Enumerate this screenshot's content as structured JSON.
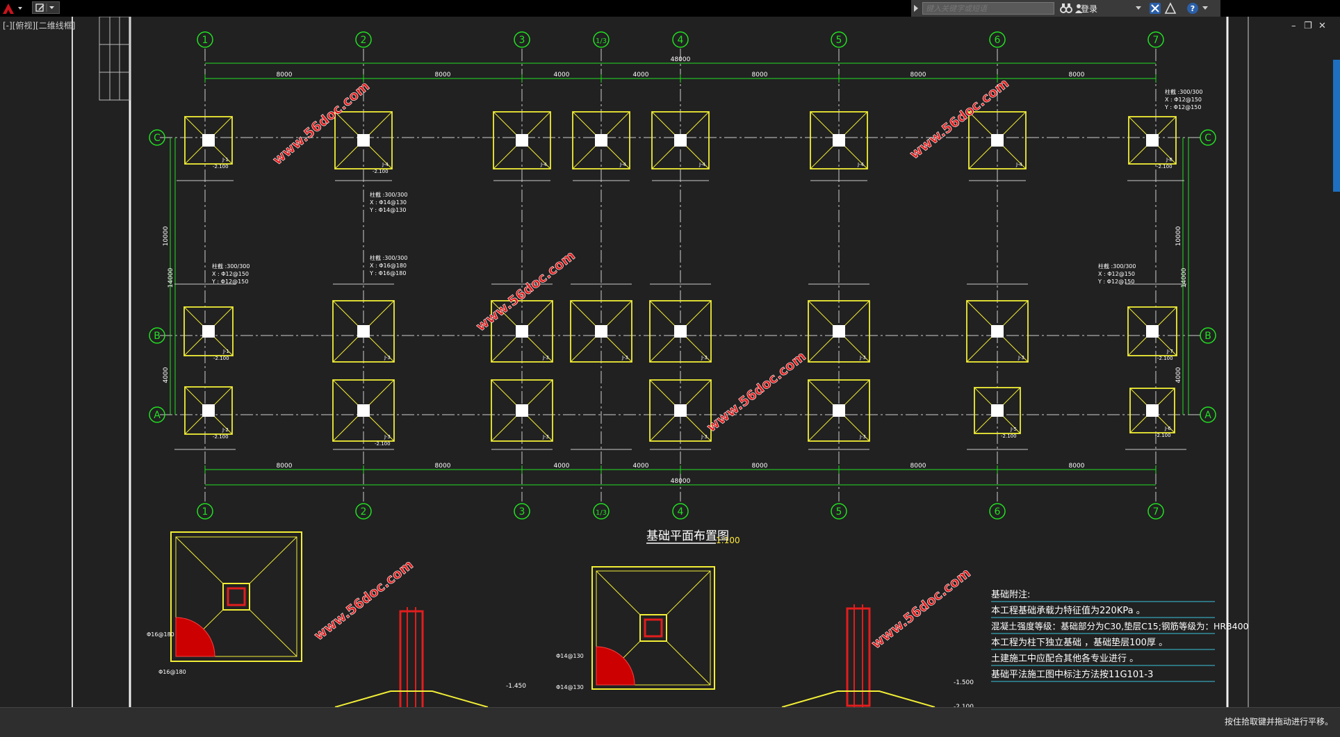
{
  "app": {
    "search_placeholder": "键入关键字或短语",
    "login_label": "登录",
    "view_label": "[-][俯视][二维线框]",
    "status_text": "按住拾取键并拖动进行平移。",
    "window_controls": [
      "–",
      "❐",
      "✕"
    ]
  },
  "drawing": {
    "plan_title": "基础平面布置图",
    "plan_scale": "1:100",
    "overall_dim": "48000",
    "bays_top": [
      "8000",
      "8000",
      "4000",
      "4000",
      "8000",
      "8000",
      "8000"
    ],
    "grid_cols": [
      "1",
      "2",
      "3",
      "1/3",
      "4",
      "5",
      "6",
      "7"
    ],
    "grid_rows": [
      "C",
      "B",
      "A"
    ],
    "left_dims": [
      "10000",
      "14000",
      "4000"
    ],
    "watermark": "www.56doc.com",
    "notes_title": "基础附注:",
    "notes": [
      "本工程基础承载力特征值为220KPa 。",
      "混凝土强度等级：基础部分为C30,垫层C15;钢筋等级为：HRB400",
      "本工程为柱下独立基础 ，基础垫层100厚 。",
      "土建施工中应配合其他各专业进行 。",
      "基础平法施工图中标注方法按11G101-3"
    ],
    "footing_labels": [
      "J-1",
      "J-2",
      "J-3",
      "J-4",
      "J-5",
      "J-6",
      "J-7",
      "J-8"
    ],
    "elev_label": "-2.100",
    "detail_rebar": [
      "Φ16@180",
      "Φ16@180",
      "Φ14@130",
      "Φ14@130"
    ],
    "detail_elev": [
      "-1.450",
      "-1.500",
      "-2.100"
    ],
    "pile_note_1": [
      "柱截 :300/300",
      "X : Φ14@130",
      "Y : Φ14@130"
    ],
    "pile_note_2": [
      "柱截 :300/300",
      "X : Φ16@180",
      "Y : Φ16@180"
    ],
    "pile_note_3": [
      "柱截 :300/300",
      "X : Φ12@150",
      "Y : Φ12@150"
    ]
  }
}
